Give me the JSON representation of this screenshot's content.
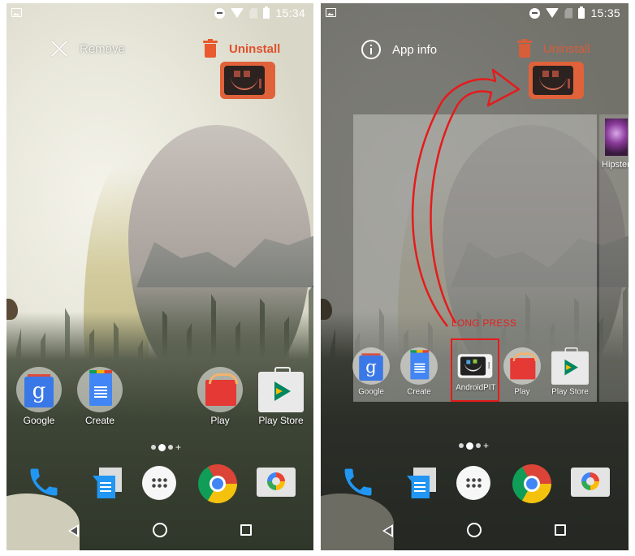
{
  "screens": [
    {
      "id": "left",
      "status_bar": {
        "time": "15:34",
        "icons": [
          "gallery-icon",
          "do-not-disturb-icon",
          "wifi-icon",
          "no-sim-icon",
          "battery-icon"
        ]
      },
      "drop_targets": {
        "remove_label": "Remove",
        "uninstall_label": "Uninstall"
      },
      "home_apps": [
        {
          "label": "Google",
          "icon": "google-folder-icon"
        },
        {
          "label": "Create",
          "icon": "create-folder-icon"
        },
        {
          "label": "Play",
          "icon": "play-folder-icon"
        },
        {
          "label": "Play Store",
          "icon": "play-store-icon"
        }
      ],
      "page_indicator": {
        "pages": 3,
        "active_index": 1,
        "has_add": true
      },
      "dock": [
        "phone-icon",
        "messenger-icon",
        "app-drawer-icon",
        "chrome-icon",
        "camera-icon"
      ],
      "nav": [
        "back-icon",
        "home-icon",
        "recents-icon"
      ]
    },
    {
      "id": "right",
      "status_bar": {
        "time": "15:35",
        "icons": [
          "gallery-icon",
          "do-not-disturb-icon",
          "wifi-icon",
          "no-sim-icon",
          "battery-icon"
        ]
      },
      "drop_targets": {
        "app_info_label": "App info",
        "uninstall_label": "Uninstall"
      },
      "overview_apps": [
        {
          "label": "Google",
          "icon": "google-folder-icon"
        },
        {
          "label": "Create",
          "icon": "create-folder-icon"
        },
        {
          "label": "AndroidPIT",
          "icon": "androidpit-icon"
        },
        {
          "label": "Play",
          "icon": "play-folder-icon"
        },
        {
          "label": "Play Store",
          "icon": "play-store-icon"
        }
      ],
      "next_page_app": {
        "label": "Hipster"
      },
      "annotation": {
        "text": "LONG PRESS",
        "color": "#e8201c"
      },
      "page_indicator": {
        "pages": 3,
        "active_index": 1,
        "has_add": true
      },
      "dock": [
        "phone-icon",
        "messenger-icon",
        "app-drawer-icon",
        "chrome-icon",
        "camera-icon"
      ],
      "nav": [
        "back-icon",
        "home-icon",
        "recents-icon"
      ]
    }
  ],
  "colors": {
    "uninstall": "#e85a30",
    "annotation_red": "#e51b1b",
    "dragged_icon": "#e0623a"
  }
}
